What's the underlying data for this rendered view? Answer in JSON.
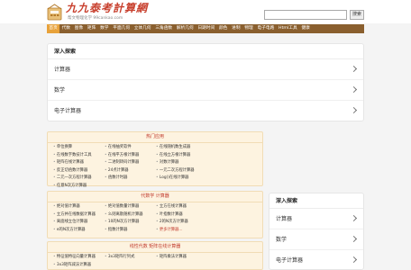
{
  "header": {
    "logo_title": "九九泰考計算網",
    "logo_slogan": "帮文物理化学 99cankao.com",
    "search_placeholder": "",
    "search_button": "搜索"
  },
  "nav": [
    "首页",
    "代数",
    "图像",
    "矩阵",
    "数学",
    "平面几何",
    "立体几何",
    "三角函数",
    "解析几何",
    "日期时间",
    "颜色",
    "进制",
    "物理",
    "电子电路",
    "Html工具",
    "健康"
  ],
  "explore": {
    "title": "深入探索",
    "items": [
      "计算器",
      "数学",
      "电子计算器"
    ]
  },
  "sections": [
    {
      "title": "热门应用",
      "items": [
        "单位换算",
        "在线抽奖软件",
        "在线随机数生成器",
        "在线数字数技计工具",
        "在线平方根计算器",
        "在线立方根计算器",
        "矩阵在线计算器",
        "二进制转码计算器",
        "对数计算器",
        "反正切函数计算器",
        "24点计算器",
        "一元二次方程计算器",
        "二元一次方程计算器",
        "函数计时器",
        "Log()在线计算器",
        "任意N次方计算器"
      ]
    },
    {
      "title": "代数学 计算器",
      "items": [
        "绝对值计算器",
        "绝对值数量计算器",
        "立方在线计算器",
        "立方并在线数据计算器",
        "么则离散随机计算器",
        "叶指数计算器",
        "离面线立位计算器",
        "10的N次方计算器",
        "2的N次方计算器",
        "e的N次方计算器",
        "指数计算器",
        "更多计算器..."
      ]
    },
    {
      "title": "线性代数 矩阵在线计算器",
      "items": [
        "特征值特征向量计算器",
        "3x3矩阵行列式",
        "矩阵乘法计算器",
        "3x3矩阵减法计算器"
      ]
    }
  ]
}
